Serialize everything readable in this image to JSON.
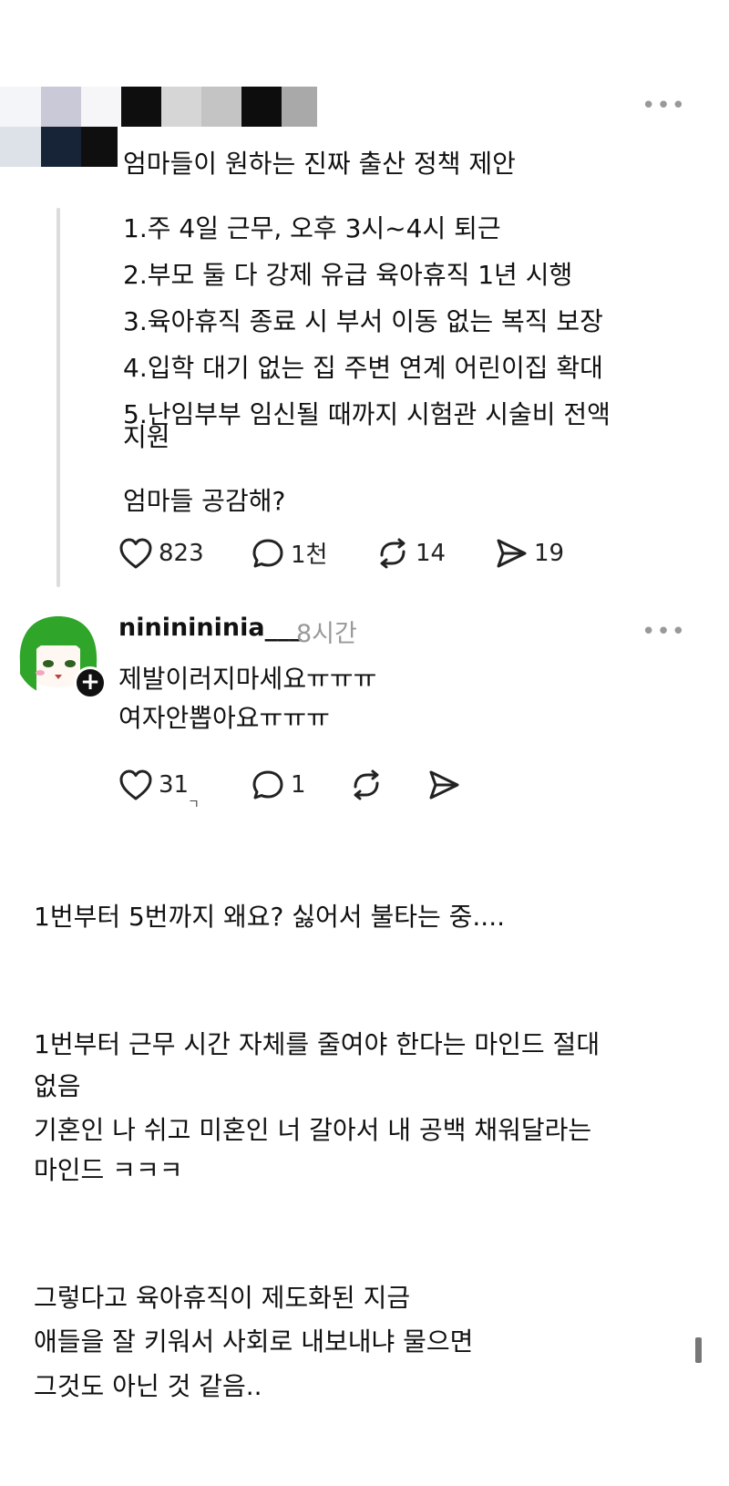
{
  "post": {
    "title": "엄마들이 원하는 진짜 출산 정책 제안",
    "items": [
      "1.주 4일 근무, 오후 3시~4시 퇴근",
      "2.부모 둘 다 강제 유급 육아휴직 1년 시행",
      "3.육아휴직 종료 시 부서 이동 없는 복직 보장",
      "4.입학 대기 없는 집 주변 연계 어린이집 확대",
      "5.난임부부 임신될 때까지 시험관 시술비 전액"
    ],
    "item_continuation": "지원",
    "question": "엄마들 공감해?",
    "likes": "823",
    "comments": "1천",
    "reposts": "14",
    "shares": "19",
    "more_glyph": "•••"
  },
  "reply": {
    "username": "nininininia___",
    "time": "8시간",
    "line1": "제발이러지마세요ㅠㅠㅠ",
    "line2": "여자안뽑아요ㅠㅠㅠ",
    "likes": "31",
    "comments": "1",
    "stray_mark": "ㄱ",
    "follow_glyph": "+",
    "more_glyph": "•••"
  },
  "commentary": {
    "p1": "1번부터 5번까지 왜요? 싫어서 불타는 중....",
    "p2_line1": "1번부터 근무 시간 자체를 줄여야 한다는 마인드 절대",
    "p2_line2": "없음",
    "p2_line3": "기혼인 나 쉬고 미혼인 너 갈아서 내 공백 채워달라는",
    "p2_line4": "마인드 ㅋㅋㅋ",
    "p3_line1": "그렇다고 육아휴직이 제도화된 지금",
    "p3_line2": "애들을 잘 키워서 사회로 내보내냐 물으면",
    "p3_line3": "그것도 아닌 것 같음.."
  },
  "icons": {
    "like": "heart-icon",
    "comment": "comment-bubble-icon",
    "repost": "repost-icon",
    "share": "send-icon"
  },
  "colors": {
    "avatar_hair": "#2fa52a",
    "text": "#111111",
    "muted": "#999999",
    "thread_line": "#dcdcdc"
  }
}
